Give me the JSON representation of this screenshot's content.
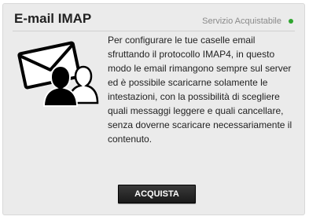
{
  "card": {
    "title": "E-mail IMAP",
    "status_text": "Servizio Acquistabile",
    "status_color": "#2fa52f",
    "icon": "envelope-users-icon",
    "description": "Per configurare le tue caselle email sfruttando il protocollo IMAP4, in questo modo le email rimangono sempre sul server ed è possibile scaricarne solamente le intestazioni, con la possibilità di scegliere quali messaggi leggere e quali cancellare, senza doverne scaricare necessariamente il contenuto.",
    "button_label": "ACQUISTA"
  }
}
